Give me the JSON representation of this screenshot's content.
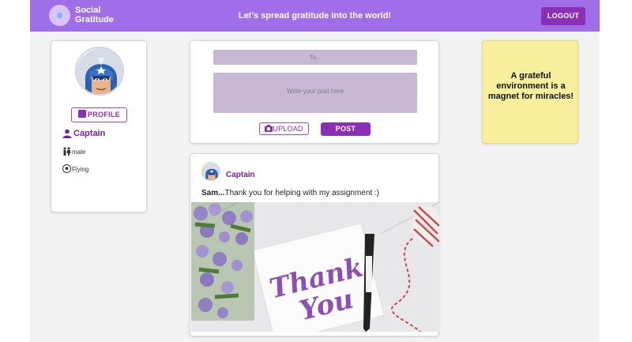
{
  "header": {
    "brand": "Social Gratitude",
    "tagline": "Let's spread gratitude into the world!",
    "logout_label": "LOGOUT"
  },
  "profile": {
    "profile_button_label": "PROFILE",
    "name": "Captain",
    "gender": "male",
    "hobby": "Flying"
  },
  "composer": {
    "to_placeholder": "To...",
    "post_placeholder": "Write your post here",
    "upload_label": "UPLOAD",
    "post_label": "POST"
  },
  "feed": [
    {
      "author": "Captain",
      "recipient": "Sam...",
      "message": "Thank you for helping with my assignment :)",
      "image_text": "Thank You"
    }
  ],
  "quote": {
    "text": "A grateful environment is a magnet for miracles!"
  },
  "colors": {
    "appbar": "#a06ee8",
    "accent": "#8b2fb5",
    "field_bg": "#c7b8d6",
    "note_bg": "#f7ef9c"
  }
}
